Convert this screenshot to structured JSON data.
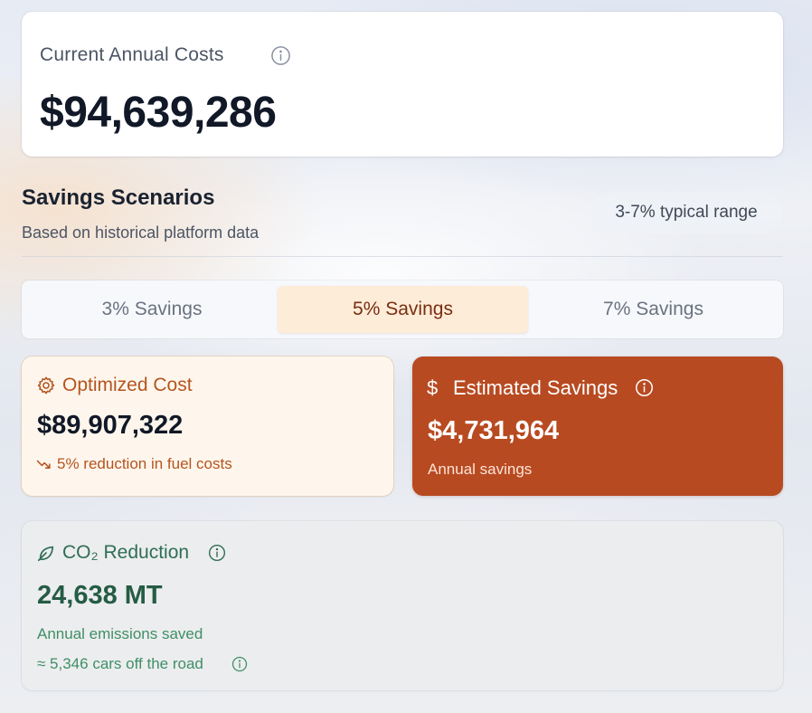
{
  "current_costs": {
    "label": "Current Annual Costs",
    "value": "$94,639,286",
    "info_icon": "info-icon"
  },
  "scenarios": {
    "title": "Savings Scenarios",
    "subtitle": "Based on historical platform data",
    "range_badge": "3-7% typical range"
  },
  "tabs": [
    {
      "label": "3% Savings",
      "selected": false
    },
    {
      "label": "5% Savings",
      "selected": true
    },
    {
      "label": "7% Savings",
      "selected": false
    }
  ],
  "optimized": {
    "icon": "gear-icon",
    "title": "Optimized Cost",
    "value": "$89,907,322",
    "trend_icon": "trending-down-icon",
    "note": "5% reduction in fuel costs"
  },
  "savings": {
    "icon": "dollar-icon",
    "icon_glyph": "$",
    "title": "Estimated Savings",
    "value": "$4,731,964",
    "note": "Annual savings",
    "info_icon": "info-icon"
  },
  "co2": {
    "icon": "leaf-icon",
    "title": "CO₂ Reduction",
    "value": "24,638 MT",
    "note": "Annual emissions saved",
    "cars": "≈ 5,346 cars off the road",
    "info_icon": "info-icon"
  },
  "colors": {
    "accent_orange": "#b84a21",
    "selected_tab_bg": "#fdecd8",
    "optimized_bg": "#fef6ec",
    "co2_green": "#2f6e55"
  }
}
